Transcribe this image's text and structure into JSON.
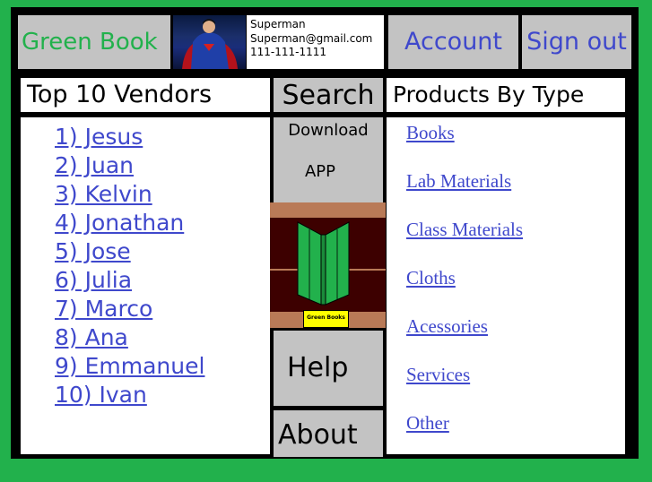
{
  "header": {
    "brand": "Green Book",
    "user": {
      "name": "Superman",
      "email": "Superman@gmail.com",
      "phone": "111-111-1111"
    },
    "account_label": "Account",
    "signout_label": "Sign out"
  },
  "vendors": {
    "title": "Top 10 Vendors",
    "items": [
      "1) Jesus",
      "2) Juan",
      "3) Kelvin",
      "4) Jonathan",
      "5) Jose",
      "6) Julia",
      "7) Marco",
      "8) Ana",
      "9) Emmanuel",
      "10) Ivan"
    ]
  },
  "middle": {
    "search_label": "Search",
    "download_line1": "Download",
    "download_line2": "APP",
    "logo_text": "Green Books",
    "help_label": "Help",
    "about_label": "About"
  },
  "products": {
    "title": "Products By Type",
    "items": [
      "Books",
      "Lab Materials",
      "Class Materials",
      "Cloths",
      "Acessories",
      "Services",
      "Other"
    ]
  },
  "colors": {
    "page_border": "#22b14c",
    "brand_green": "#22b14c",
    "link_blue": "#3f48cc",
    "panel_grey": "#c3c3c3",
    "frame": "#000000"
  }
}
